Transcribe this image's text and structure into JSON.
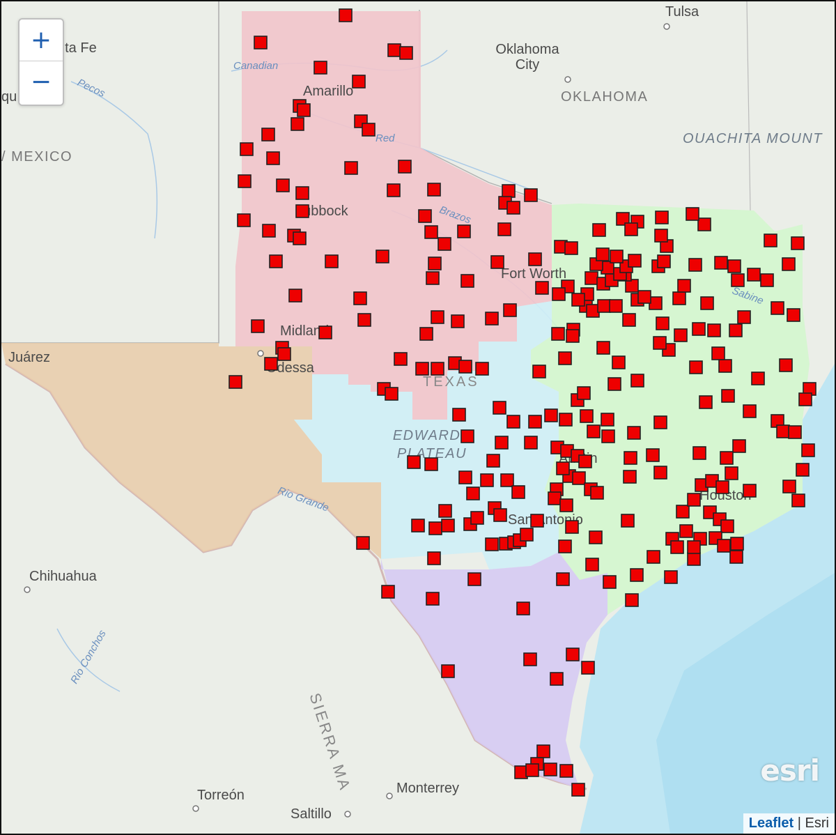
{
  "zoom_control": {
    "zoom_in_label": "+",
    "zoom_out_label": "−"
  },
  "attribution": {
    "leaflet_link": "Leaflet",
    "separator": "|",
    "provider": "Esri"
  },
  "logo": {
    "text": "esri"
  },
  "colors": {
    "region_panhandle": "#f2c4cb",
    "region_far_west": "#e9cba9",
    "region_central_west": "#cfeef6",
    "region_south": "#d6caf3",
    "region_east": "#d2f7cd",
    "marker_fill": "#ee0000",
    "marker_stroke": "#222222",
    "water": "#bfe6f3"
  },
  "map_labels": {
    "santa_fe": "nta Fe",
    "tulsa": "Tulsa",
    "oklahoma_city": "Oklahoma City",
    "oklahoma_state": "OKLAHOMA",
    "ouachita": "OUACHITA MOUNT",
    "albuquerque": "qu",
    "new_mexico": "/ MEXICO",
    "canadian_river": "Canadian",
    "pecos_river": "Pecos",
    "red_river": "Red",
    "amarillo": "Amarillo",
    "lubbock": "Lubbock",
    "brazos_river": "Brazos",
    "fort_worth": "Fort Worth",
    "sabine_river": "Sabine",
    "midland": "Midland",
    "juarez": "Juárez",
    "odessa": "Odessa",
    "texas_state": "TEXAS",
    "edwards_plateau": "EDWARDS PLATEAU",
    "austin": "Austin",
    "houston": "Houston",
    "rio_grande": "Rio Grande",
    "san_antonio": "San Antonio",
    "chihuahua": "Chihuahua",
    "rio_conchos": "Rio Conchos",
    "sierra": "SIERRA MA",
    "monterrey": "Monterrey",
    "torreon": "Torreón",
    "saltillo": "Saltillo"
  }
}
